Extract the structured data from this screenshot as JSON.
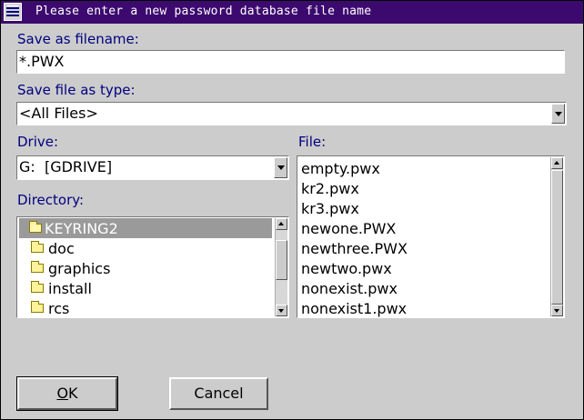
{
  "window": {
    "title": "Please enter a new password database file name"
  },
  "save_as": {
    "label": "Save as filename:",
    "value": "*.PWX"
  },
  "file_type": {
    "label": "Save file as type:",
    "value": "<All Files>"
  },
  "drive": {
    "label": "Drive:",
    "value": "G:  [GDRIVE]"
  },
  "directory": {
    "label": "Directory:",
    "items": [
      {
        "name": "KEYRING2",
        "selected": true,
        "open": true
      },
      {
        "name": "doc"
      },
      {
        "name": "graphics"
      },
      {
        "name": "install"
      },
      {
        "name": "rcs"
      }
    ]
  },
  "file": {
    "label": "File:",
    "items": [
      "empty.pwx",
      "kr2.pwx",
      "kr3.pwx",
      "newone.PWX",
      "newthree.PWX",
      "newtwo.pwx",
      "nonexist.pwx",
      "nonexist1.pwx"
    ]
  },
  "buttons": {
    "ok_mnemonic": "O",
    "ok_rest": "K",
    "cancel": "Cancel"
  }
}
